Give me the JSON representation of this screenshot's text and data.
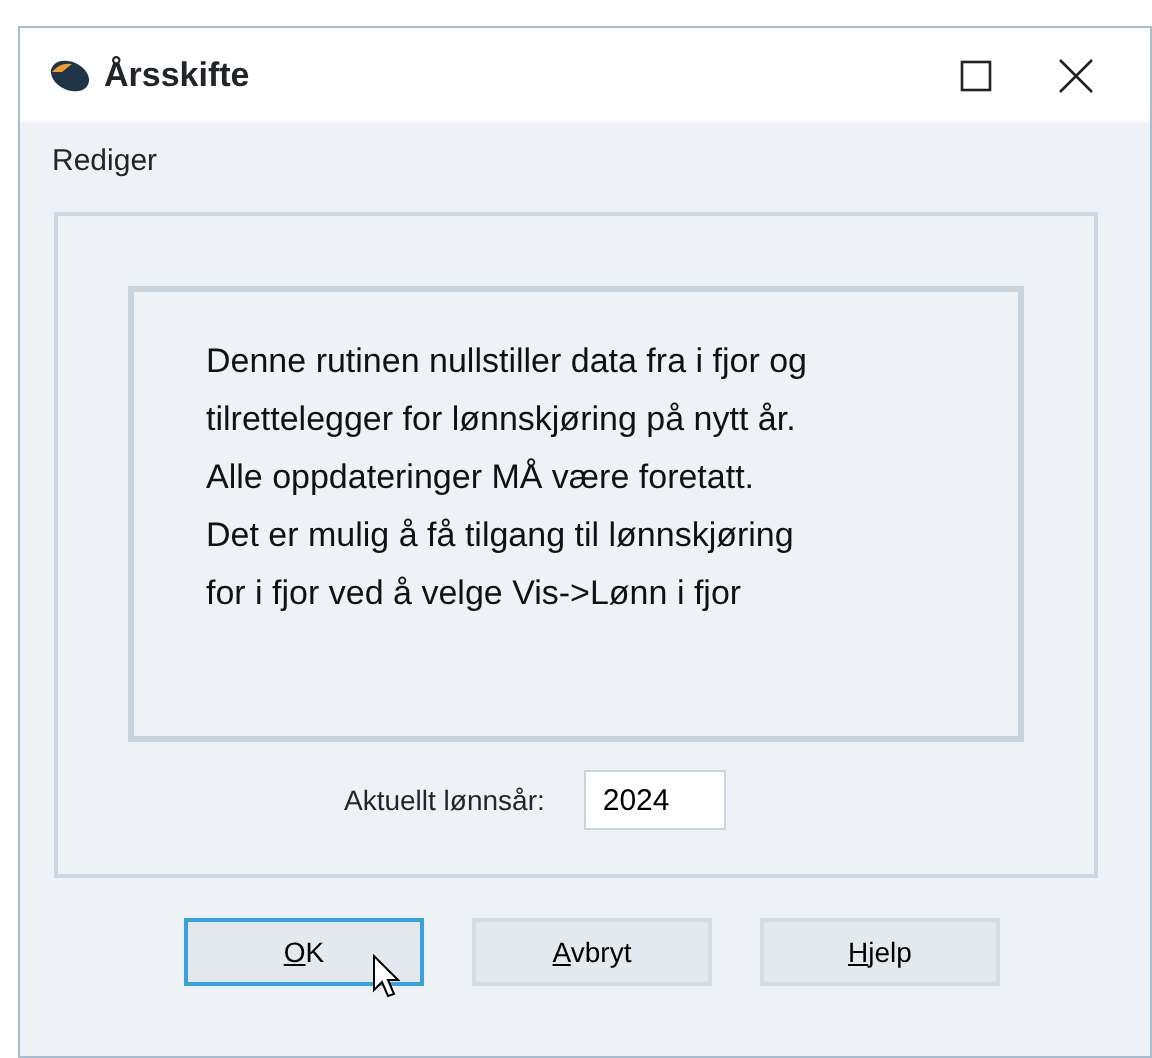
{
  "window": {
    "title": "Årsskifte"
  },
  "menu": [
    "Rediger"
  ],
  "message": "Denne rutinen nullstiller data fra i fjor og tilrettelegger for lønnskjøring på nytt år. Alle oppdateringer MÅ være foretatt. Det er mulig å få tilgang til lønnskjøring for i fjor ved å velge Vis->Lønn i fjor",
  "year_field": {
    "label": "Aktuellt lønnsår:",
    "value": "2024"
  },
  "buttons": [
    {
      "label": "OK",
      "underline_first": true,
      "focused": true,
      "hovered": true
    },
    {
      "label": "Avbryt",
      "underline_first": true,
      "focused": false,
      "hovered": false
    },
    {
      "label": "Hjelp",
      "underline_first": true,
      "focused": false,
      "hovered": false
    }
  ]
}
